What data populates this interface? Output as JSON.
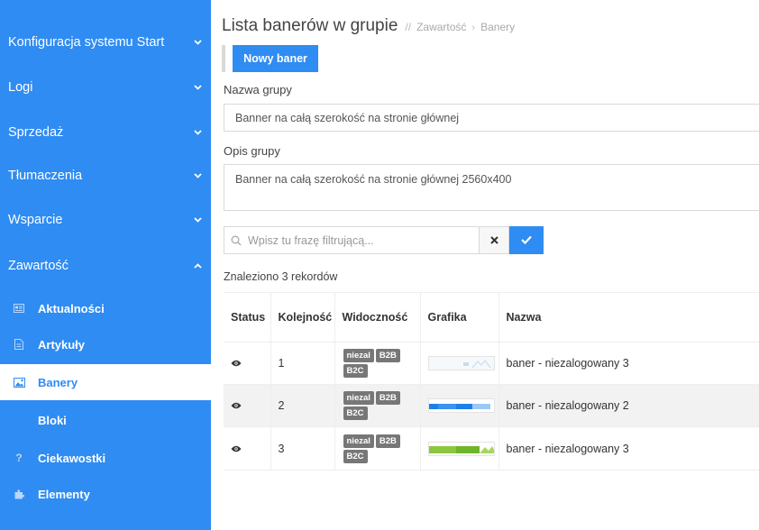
{
  "sidebar": {
    "sections": [
      {
        "label": "Konfiguracja systemu Start",
        "chevron": "chevron-down-icon"
      },
      {
        "label": "Logi",
        "chevron": "chevron-down-icon"
      },
      {
        "label": "Sprzedaż",
        "chevron": "chevron-down-icon"
      },
      {
        "label": "Tłumaczenia",
        "chevron": "chevron-down-icon"
      },
      {
        "label": "Wsparcie",
        "chevron": "chevron-down-icon"
      },
      {
        "label": "Zawartość",
        "chevron": "chevron-up-icon"
      }
    ],
    "subitems": [
      {
        "label": "Aktualności",
        "icon": "newspaper-icon",
        "active": false
      },
      {
        "label": "Artykuły",
        "icon": "document-icon",
        "active": false
      },
      {
        "label": "Banery",
        "icon": "image-icon",
        "active": true
      },
      {
        "label": "Bloki",
        "icon": "",
        "active": false
      },
      {
        "label": "Ciekawostki",
        "icon": "question-icon",
        "active": false
      },
      {
        "label": "Elementy",
        "icon": "puzzle-icon",
        "active": false
      }
    ]
  },
  "header": {
    "title": "Lista banerów w grupie",
    "separator": "//",
    "breadcrumb": [
      "Zawartość",
      "Banery"
    ]
  },
  "toolbar": {
    "new_button": "Nowy baner"
  },
  "form": {
    "group_name_label": "Nazwa grupy",
    "group_name_value": "Banner na całą szerokość na stronie głównej",
    "group_desc_label": "Opis grupy",
    "group_desc_value": "Banner na całą szerokość na stronie głównej 2560x400"
  },
  "search": {
    "placeholder": "Wpisz tu frazę filtrującą...",
    "clear_icon": "close-icon",
    "submit_icon": "check-icon"
  },
  "results": {
    "count_text": "Znaleziono 3 rekordów"
  },
  "table": {
    "headers": [
      "Status",
      "Kolejność",
      "Widoczność",
      "Grafika",
      "Nazwa"
    ],
    "rows": [
      {
        "status_icon": "eye-icon",
        "order": "1",
        "badges": [
          "niezal",
          "B2B",
          "B2C"
        ],
        "name": "baner - niezalogowany 3"
      },
      {
        "status_icon": "eye-icon",
        "order": "2",
        "badges": [
          "niezal",
          "B2B",
          "B2C"
        ],
        "name": "baner - niezalogowany 2"
      },
      {
        "status_icon": "eye-icon",
        "order": "3",
        "badges": [
          "niezal",
          "B2B",
          "B2C"
        ],
        "name": "baner - niezalogowany 3"
      }
    ]
  },
  "colors": {
    "accent": "#2f8cf2",
    "badge": "#777777",
    "sidebar_text": "#ffffff"
  }
}
